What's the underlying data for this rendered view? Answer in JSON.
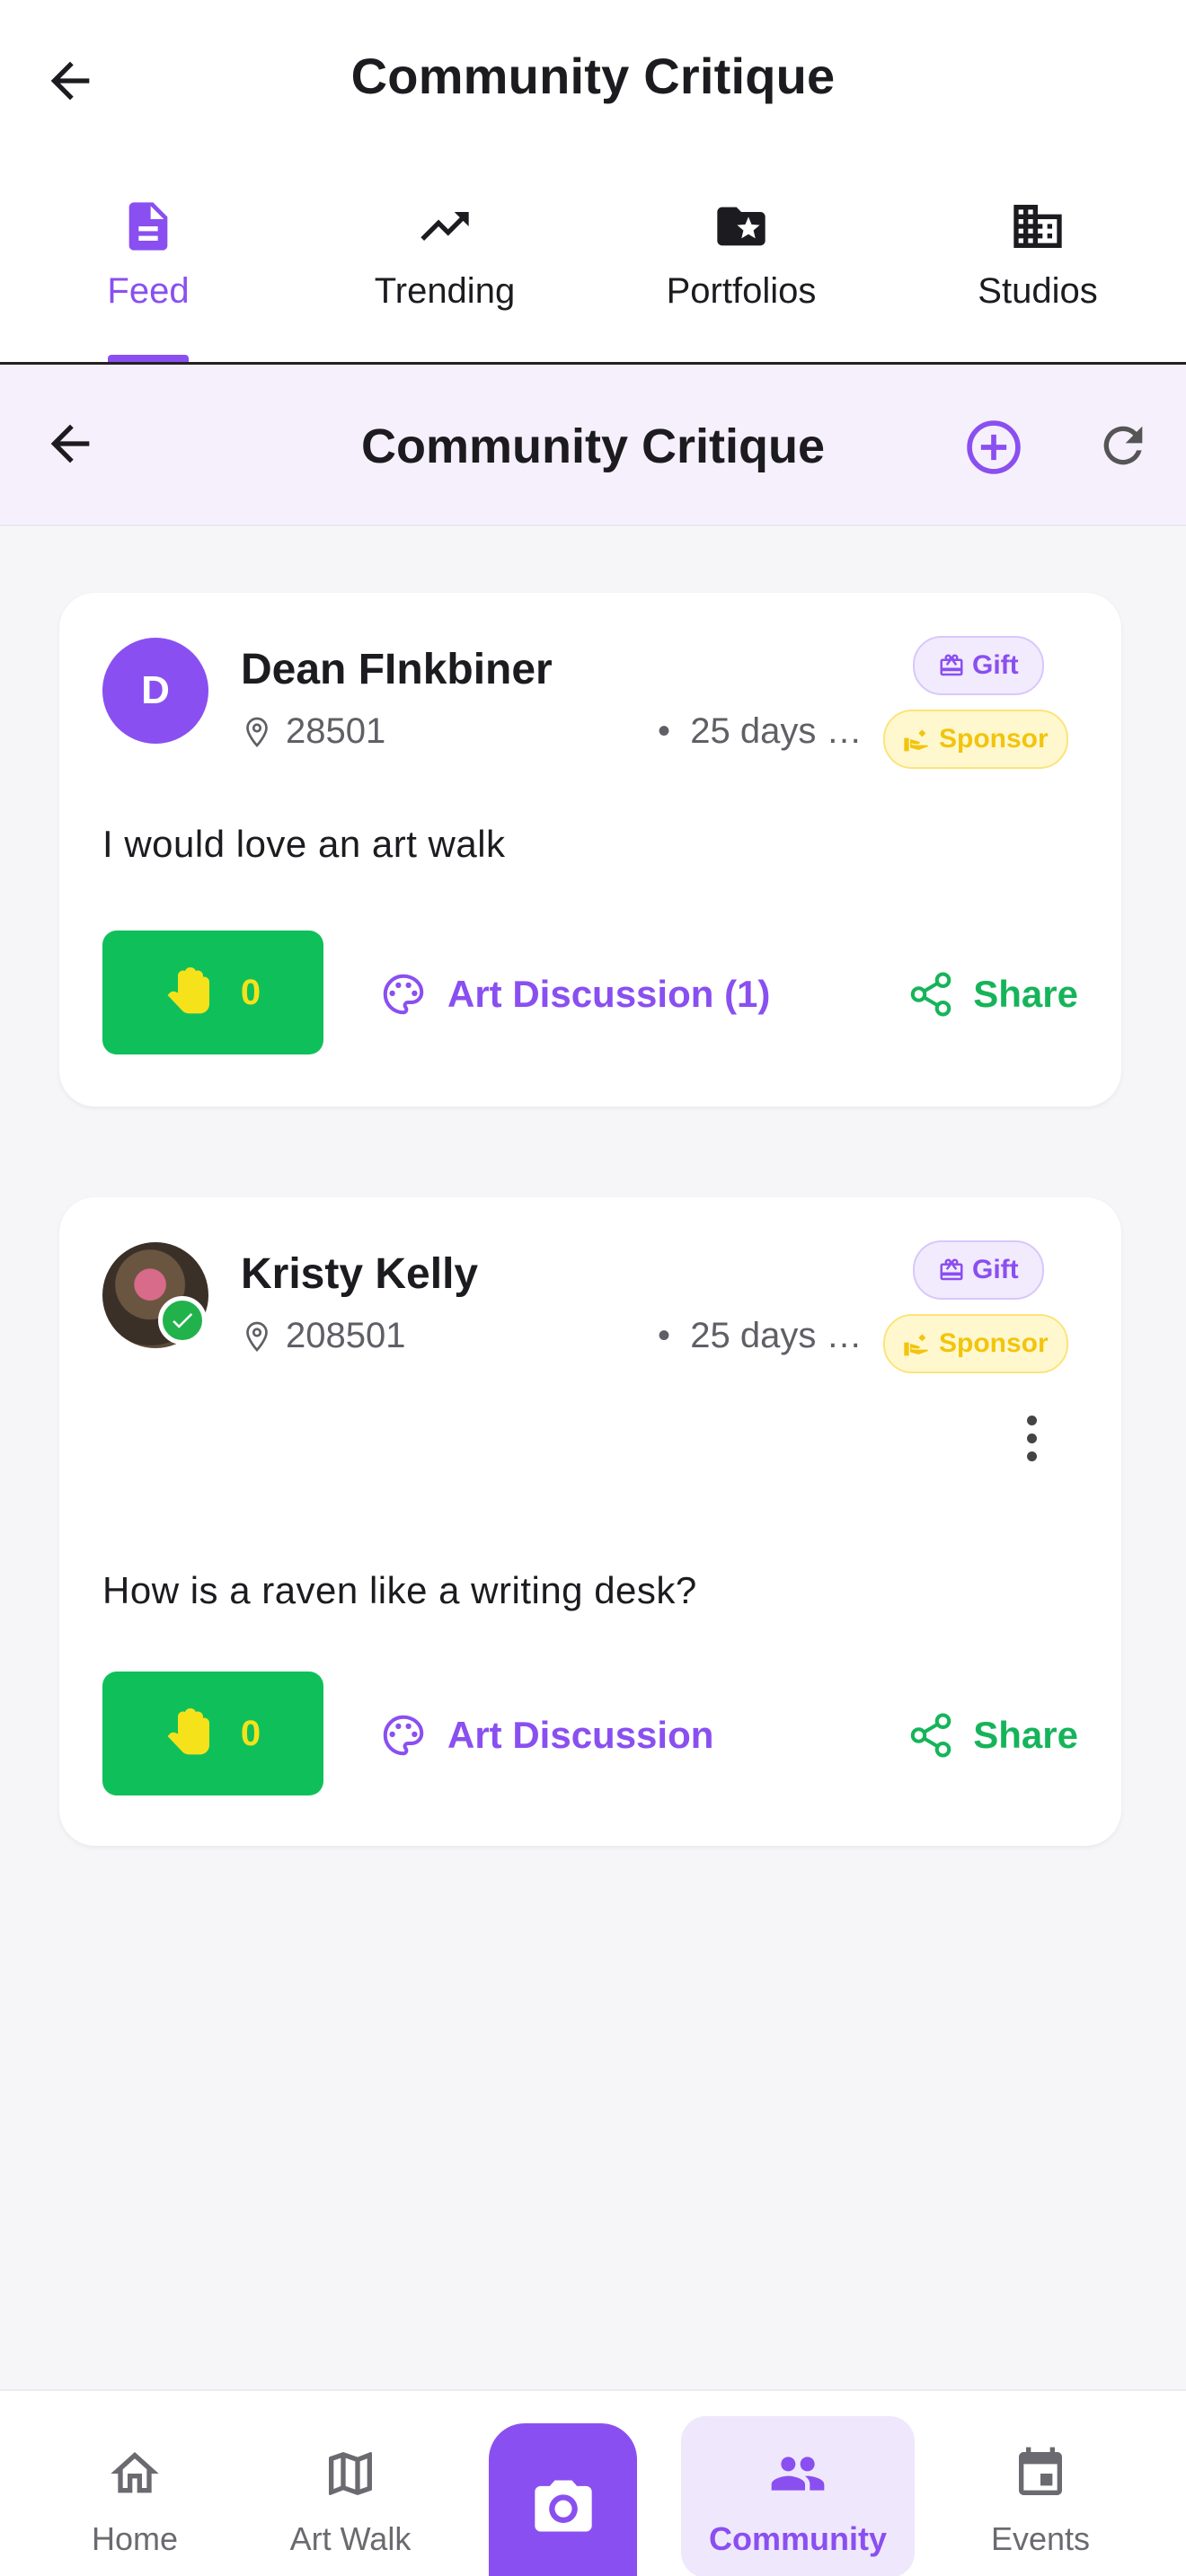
{
  "appbar": {
    "title": "Community Critique"
  },
  "tabs": [
    {
      "label": "Feed",
      "icon": "article-icon",
      "active": true
    },
    {
      "label": "Trending",
      "icon": "trending-up-icon"
    },
    {
      "label": "Portfolios",
      "icon": "folder-star-icon"
    },
    {
      "label": "Studios",
      "icon": "building-icon"
    }
  ],
  "subheader": {
    "title": "Community Critique"
  },
  "posts": [
    {
      "avatar_initial": "D",
      "name": "Dean FInkbiner",
      "location": "28501",
      "time": "25 days …",
      "badge_gift": "Gift",
      "badge_sponsor": "Sponsor",
      "message": "I would love an art walk",
      "hands_count": "0",
      "discussion_label": "Art Discussion (1)",
      "share_label": "Share"
    },
    {
      "avatar_initial": "",
      "name": "Kristy Kelly",
      "location": "208501",
      "time": "25 days …",
      "badge_gift": "Gift",
      "badge_sponsor": "Sponsor",
      "message": "How is a raven like a writing desk?",
      "hands_count": "0",
      "discussion_label": "Art Discussion",
      "share_label": "Share"
    }
  ],
  "bottom_nav": [
    {
      "label": "Home",
      "icon": "home-icon"
    },
    {
      "label": "Art Walk",
      "icon": "map-icon"
    },
    {
      "label": "",
      "icon": "camera-icon"
    },
    {
      "label": "Community",
      "icon": "people-icon",
      "active": true
    },
    {
      "label": "Events",
      "icon": "calendar-icon"
    }
  ],
  "colors": {
    "accent": "#8a4ff0",
    "green": "#0fc05a",
    "sponsor": "#f2c40c"
  }
}
